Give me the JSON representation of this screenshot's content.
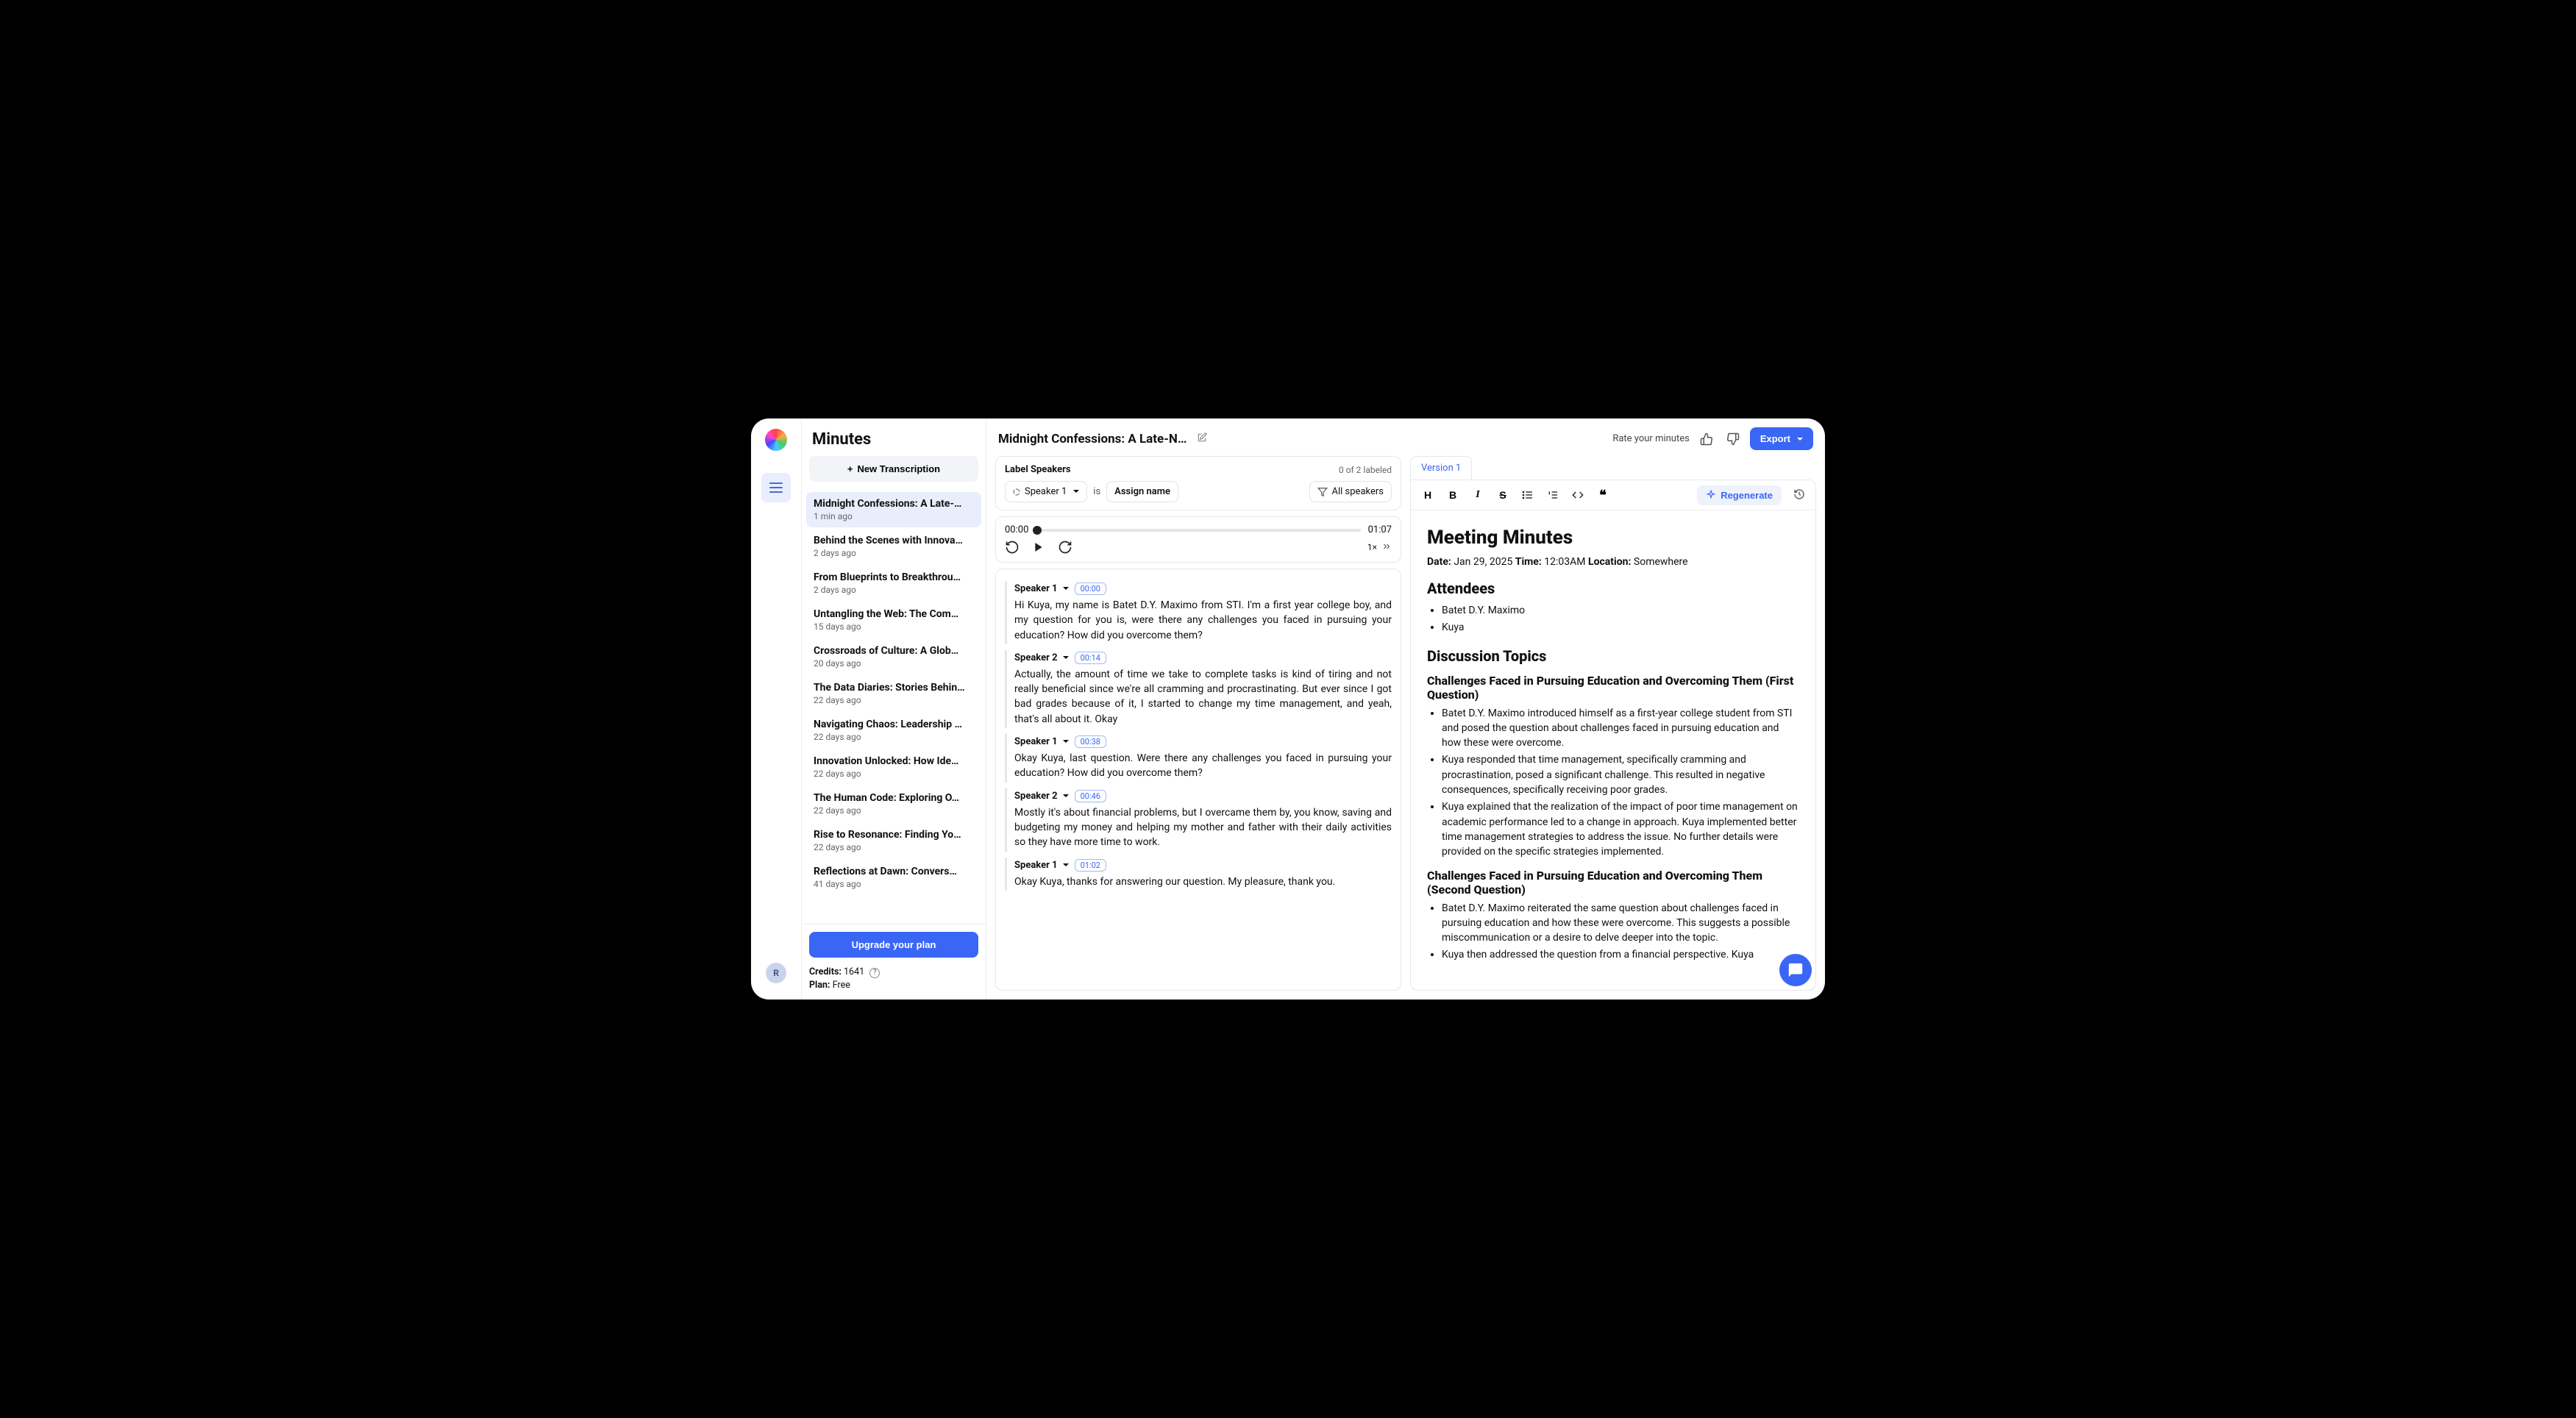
{
  "sidebar": {
    "title": "Minutes",
    "new_transcription": "New Transcription",
    "items": [
      {
        "title": "Midnight Confessions: A Late-…",
        "time": "1 min ago",
        "active": true
      },
      {
        "title": "Behind the Scenes with Innova…",
        "time": "2 days ago"
      },
      {
        "title": "From Blueprints to Breakthrou…",
        "time": "2 days ago"
      },
      {
        "title": "Untangling the Web: The Com…",
        "time": "15 days ago"
      },
      {
        "title": "Crossroads of Culture: A Glob…",
        "time": "20 days ago"
      },
      {
        "title": "The Data Diaries: Stories Behin…",
        "time": "22 days ago"
      },
      {
        "title": "Navigating Chaos: Leadership …",
        "time": "22 days ago"
      },
      {
        "title": "Innovation Unlocked: How Ide…",
        "time": "22 days ago"
      },
      {
        "title": "The Human Code: Exploring O…",
        "time": "22 days ago"
      },
      {
        "title": "Rise to Resonance: Finding Yo…",
        "time": "22 days ago"
      },
      {
        "title": "Reflections at Dawn: Convers…",
        "time": "41 days ago"
      }
    ],
    "upgrade": "Upgrade your plan",
    "credits_label": "Credits:",
    "credits_value": "1641",
    "plan_label": "Plan:",
    "plan_value": "Free",
    "avatar_initial": "R"
  },
  "header": {
    "doc_title": "Midnight Confessions: A Late-Night D…",
    "rate_label": "Rate your minutes",
    "export": "Export"
  },
  "labeler": {
    "heading": "Label Speakers",
    "status": "0 of 2 labeled",
    "speaker": "Speaker 1",
    "is": "is",
    "assign": "Assign name",
    "filter": "All speakers"
  },
  "player": {
    "current": "00:00",
    "total": "01:07",
    "speed": "1×"
  },
  "segments": [
    {
      "speaker": "Speaker 1",
      "ts": "00:00",
      "text": "Hi Kuya, my name is Batet D.Y. Maximo from STI. I'm a first year college boy, and my question for you is, were there any challenges you faced in pursuing your education? How did you overcome them?"
    },
    {
      "speaker": "Speaker 2",
      "ts": "00:14",
      "text": "Actually, the amount of time we take to complete tasks is kind of tiring and not really beneficial since we're all cramming and procrastinating. But ever since I got bad grades because of it, I started to change my time management, and yeah, that's all about it. Okay"
    },
    {
      "speaker": "Speaker 1",
      "ts": "00:38",
      "text": "Okay Kuya, last question. Were there any challenges you faced in pursuing your education? How did you overcome them?"
    },
    {
      "speaker": "Speaker 2",
      "ts": "00:46",
      "text": "Mostly it's about financial problems, but I overcame them by, you know, saving and budgeting my money and helping my mother and father with their daily activities so they have more time to work."
    },
    {
      "speaker": "Speaker 1",
      "ts": "01:02",
      "text": "Okay Kuya, thanks for answering our question. My pleasure, thank you."
    }
  ],
  "minutes": {
    "version_tab": "Version 1",
    "regenerate": "Regenerate",
    "title": "Meeting Minutes",
    "date_label": "Date:",
    "date_value": "Jan 29, 2025",
    "time_label": "Time:",
    "time_value": "12:03AM",
    "location_label": "Location:",
    "location_value": "Somewhere",
    "attendees_heading": "Attendees",
    "attendees": [
      "Batet D.Y. Maximo",
      "Kuya"
    ],
    "topics_heading": "Discussion Topics",
    "topic1_heading": "Challenges Faced in Pursuing Education and Overcoming Them (First Question)",
    "topic1_bullets": [
      "Batet D.Y. Maximo introduced himself as a first-year college student from STI and posed the question about challenges faced in pursuing education and how these were overcome.",
      "Kuya responded that time management, specifically cramming and procrastination, posed a significant challenge. This resulted in negative consequences, specifically receiving poor grades.",
      "Kuya explained that the realization of the impact of poor time management on academic performance led to a change in approach. Kuya implemented better time management strategies to address the issue. No further details were provided on the specific strategies implemented."
    ],
    "topic2_heading": "Challenges Faced in Pursuing Education and Overcoming Them (Second Question)",
    "topic2_bullets": [
      "Batet D.Y. Maximo reiterated the same question about challenges faced in pursuing education and how these were overcome. This suggests a possible miscommunication or a desire to delve deeper into the topic.",
      "Kuya then addressed the question from a financial perspective. Kuya"
    ]
  }
}
